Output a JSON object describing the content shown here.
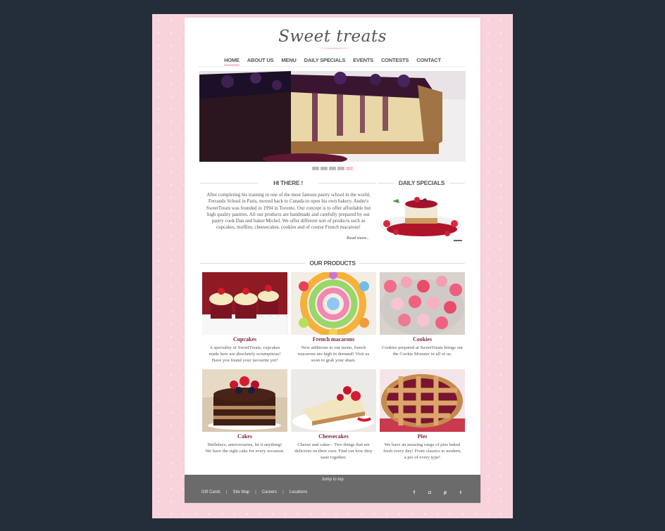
{
  "brand": {
    "logo": "Sweet treats"
  },
  "nav": {
    "items": [
      "HOME",
      "ABOUT US",
      "MENU",
      "DAILY SPECIALS",
      "EVENTS",
      "CONTESTS",
      "CONTACT"
    ],
    "active": "HOME"
  },
  "slider": {
    "dots": 5,
    "active_index": 4
  },
  "intro": {
    "title": "HI THERE !",
    "text": "After completing his training in one of the most famous pastry school in the world, Ferrands School in Paris, moved back to Canada to open his own bakery. Andre's SweetTreats was founded in 1994 in Toronto. Our concept is to offer affordable but high quality pastries. All our products are handmade and carefully prepared by our pastry cook Dan and baker Michel. We offer different sort of products such as cupcakes, muffins, cheesecakes, cookies and of course French macarons!",
    "read_more": "Read more.."
  },
  "daily_specials": {
    "title": "DAILY SPECIALS"
  },
  "products": {
    "title": "OUR PRODUCTS",
    "items": [
      {
        "name": "Cupcakes",
        "desc": "A speciality of SweetTreats, cupcakes made here are absolutely scrumptious! Have you found your favourite yet?"
      },
      {
        "name": "French macarons",
        "desc": "New additions to our menu, french macarons are high in demand! Visit us soon to grab your share."
      },
      {
        "name": "Cookies",
        "desc": "Cookies prepared at SweetTreats brings out the Cookie Monster in all of us."
      },
      {
        "name": "Cakes",
        "desc": "Birthdays, anniversaries, be it anything! We have the right cake for every occasion."
      },
      {
        "name": "Cheesecakes",
        "desc": "Cheese and cakes - Two things that are delicious on their own. Find out how they taste together."
      },
      {
        "name": "Pies",
        "desc": "We have an amazing range of pies baked fresh every day! From classics to modern, a pie of every type!"
      }
    ]
  },
  "footer": {
    "jump": "Jump to top",
    "links": [
      "Gift Cards",
      "Site Map",
      "Careers",
      "Locations"
    ],
    "separator": "|",
    "social": [
      {
        "icon": "facebook-icon",
        "glyph": "f"
      },
      {
        "icon": "instagram-icon",
        "glyph": "◘"
      },
      {
        "icon": "pinterest-icon",
        "glyph": "p"
      },
      {
        "icon": "twitter-icon",
        "glyph": "t"
      }
    ]
  },
  "colors": {
    "background": "#242e38",
    "frame": "#f9d3dc",
    "accent": "#e8829a",
    "product_name": "#7a2b3b",
    "footer": "#6b6b6b"
  }
}
